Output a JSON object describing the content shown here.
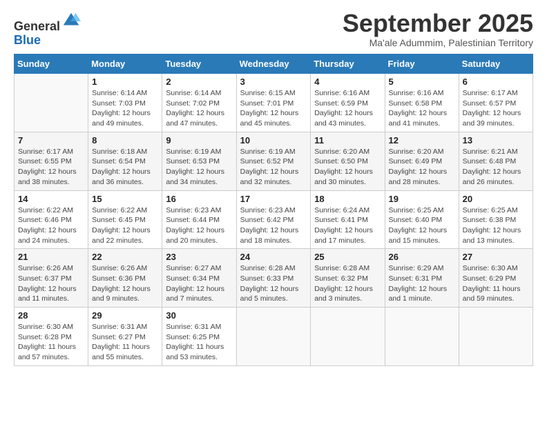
{
  "header": {
    "logo_general": "General",
    "logo_blue": "Blue",
    "month_title": "September 2025",
    "subtitle": "Ma'ale Adummim, Palestinian Territory"
  },
  "weekdays": [
    "Sunday",
    "Monday",
    "Tuesday",
    "Wednesday",
    "Thursday",
    "Friday",
    "Saturday"
  ],
  "weeks": [
    [
      {
        "day": "",
        "info": ""
      },
      {
        "day": "1",
        "info": "Sunrise: 6:14 AM\nSunset: 7:03 PM\nDaylight: 12 hours\nand 49 minutes."
      },
      {
        "day": "2",
        "info": "Sunrise: 6:14 AM\nSunset: 7:02 PM\nDaylight: 12 hours\nand 47 minutes."
      },
      {
        "day": "3",
        "info": "Sunrise: 6:15 AM\nSunset: 7:01 PM\nDaylight: 12 hours\nand 45 minutes."
      },
      {
        "day": "4",
        "info": "Sunrise: 6:16 AM\nSunset: 6:59 PM\nDaylight: 12 hours\nand 43 minutes."
      },
      {
        "day": "5",
        "info": "Sunrise: 6:16 AM\nSunset: 6:58 PM\nDaylight: 12 hours\nand 41 minutes."
      },
      {
        "day": "6",
        "info": "Sunrise: 6:17 AM\nSunset: 6:57 PM\nDaylight: 12 hours\nand 39 minutes."
      }
    ],
    [
      {
        "day": "7",
        "info": "Sunrise: 6:17 AM\nSunset: 6:55 PM\nDaylight: 12 hours\nand 38 minutes."
      },
      {
        "day": "8",
        "info": "Sunrise: 6:18 AM\nSunset: 6:54 PM\nDaylight: 12 hours\nand 36 minutes."
      },
      {
        "day": "9",
        "info": "Sunrise: 6:19 AM\nSunset: 6:53 PM\nDaylight: 12 hours\nand 34 minutes."
      },
      {
        "day": "10",
        "info": "Sunrise: 6:19 AM\nSunset: 6:52 PM\nDaylight: 12 hours\nand 32 minutes."
      },
      {
        "day": "11",
        "info": "Sunrise: 6:20 AM\nSunset: 6:50 PM\nDaylight: 12 hours\nand 30 minutes."
      },
      {
        "day": "12",
        "info": "Sunrise: 6:20 AM\nSunset: 6:49 PM\nDaylight: 12 hours\nand 28 minutes."
      },
      {
        "day": "13",
        "info": "Sunrise: 6:21 AM\nSunset: 6:48 PM\nDaylight: 12 hours\nand 26 minutes."
      }
    ],
    [
      {
        "day": "14",
        "info": "Sunrise: 6:22 AM\nSunset: 6:46 PM\nDaylight: 12 hours\nand 24 minutes."
      },
      {
        "day": "15",
        "info": "Sunrise: 6:22 AM\nSunset: 6:45 PM\nDaylight: 12 hours\nand 22 minutes."
      },
      {
        "day": "16",
        "info": "Sunrise: 6:23 AM\nSunset: 6:44 PM\nDaylight: 12 hours\nand 20 minutes."
      },
      {
        "day": "17",
        "info": "Sunrise: 6:23 AM\nSunset: 6:42 PM\nDaylight: 12 hours\nand 18 minutes."
      },
      {
        "day": "18",
        "info": "Sunrise: 6:24 AM\nSunset: 6:41 PM\nDaylight: 12 hours\nand 17 minutes."
      },
      {
        "day": "19",
        "info": "Sunrise: 6:25 AM\nSunset: 6:40 PM\nDaylight: 12 hours\nand 15 minutes."
      },
      {
        "day": "20",
        "info": "Sunrise: 6:25 AM\nSunset: 6:38 PM\nDaylight: 12 hours\nand 13 minutes."
      }
    ],
    [
      {
        "day": "21",
        "info": "Sunrise: 6:26 AM\nSunset: 6:37 PM\nDaylight: 12 hours\nand 11 minutes."
      },
      {
        "day": "22",
        "info": "Sunrise: 6:26 AM\nSunset: 6:36 PM\nDaylight: 12 hours\nand 9 minutes."
      },
      {
        "day": "23",
        "info": "Sunrise: 6:27 AM\nSunset: 6:34 PM\nDaylight: 12 hours\nand 7 minutes."
      },
      {
        "day": "24",
        "info": "Sunrise: 6:28 AM\nSunset: 6:33 PM\nDaylight: 12 hours\nand 5 minutes."
      },
      {
        "day": "25",
        "info": "Sunrise: 6:28 AM\nSunset: 6:32 PM\nDaylight: 12 hours\nand 3 minutes."
      },
      {
        "day": "26",
        "info": "Sunrise: 6:29 AM\nSunset: 6:31 PM\nDaylight: 12 hours\nand 1 minute."
      },
      {
        "day": "27",
        "info": "Sunrise: 6:30 AM\nSunset: 6:29 PM\nDaylight: 11 hours\nand 59 minutes."
      }
    ],
    [
      {
        "day": "28",
        "info": "Sunrise: 6:30 AM\nSunset: 6:28 PM\nDaylight: 11 hours\nand 57 minutes."
      },
      {
        "day": "29",
        "info": "Sunrise: 6:31 AM\nSunset: 6:27 PM\nDaylight: 11 hours\nand 55 minutes."
      },
      {
        "day": "30",
        "info": "Sunrise: 6:31 AM\nSunset: 6:25 PM\nDaylight: 11 hours\nand 53 minutes."
      },
      {
        "day": "",
        "info": ""
      },
      {
        "day": "",
        "info": ""
      },
      {
        "day": "",
        "info": ""
      },
      {
        "day": "",
        "info": ""
      }
    ]
  ]
}
